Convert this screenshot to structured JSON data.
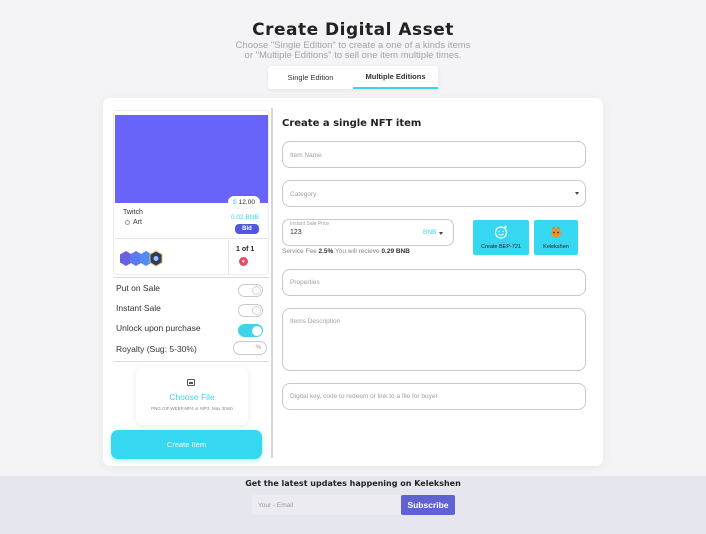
{
  "header": {
    "title": "Create Digital Asset",
    "subtitle_line1": "Choose \"Single Edition\" to create a one of a kinds items",
    "subtitle_line2": "or \"Multiple Editions\" to sell one item multiple times."
  },
  "tabs": [
    {
      "label": "Single Edition",
      "active": false
    },
    {
      "label": "Multiple Editions",
      "active": true
    }
  ],
  "preview": {
    "image_color": "#6964f9",
    "price_currency": "$",
    "price": "12.00",
    "name": "Twitch",
    "category": "Art",
    "bnb_price": "0.02 BNB",
    "bid_label": "Bid",
    "edition": "1 of 1"
  },
  "options": {
    "put_on_sale": {
      "label": "Put on Sale",
      "on": false
    },
    "instant_sale": {
      "label": "Instant Sale",
      "on": false
    },
    "unlock": {
      "label": "Unlock upon purchase",
      "on": true
    },
    "royalty": {
      "label": "Royalty (Sug: 5-30%)",
      "unit": "%"
    }
  },
  "upload": {
    "label": "Choose File",
    "formats": "PNG,GIF,WEBP,MP4 or MP3. Max 30mb"
  },
  "create_button": "Create Item",
  "form": {
    "title": "Create a single NFT item",
    "item_name_placeholder": "Item Name",
    "category_placeholder": "Category",
    "price_label": "Instant Sale Price",
    "price_value": "123",
    "price_currency": "BNB",
    "fee_prefix": "Service Fee",
    "fee_pct": "2.5%",
    "fee_mid": "You will recieve",
    "fee_amount": "0.29 BNB",
    "create_bep_label": "Create BEP-721",
    "collection_label": "Kelekshen",
    "properties_placeholder": "Properties",
    "description_placeholder": "Items Description",
    "unlock_placeholder": "Digital key, code to redeem or link to a file for buyer"
  },
  "footer": {
    "title": "Get the latest updates happening on Kelekshen",
    "email_placeholder": "Your - Email",
    "subscribe": "Subscribe"
  },
  "colors": {
    "accent": "#36d7f1",
    "primary": "#5e63d1",
    "bid": "#5258df"
  }
}
